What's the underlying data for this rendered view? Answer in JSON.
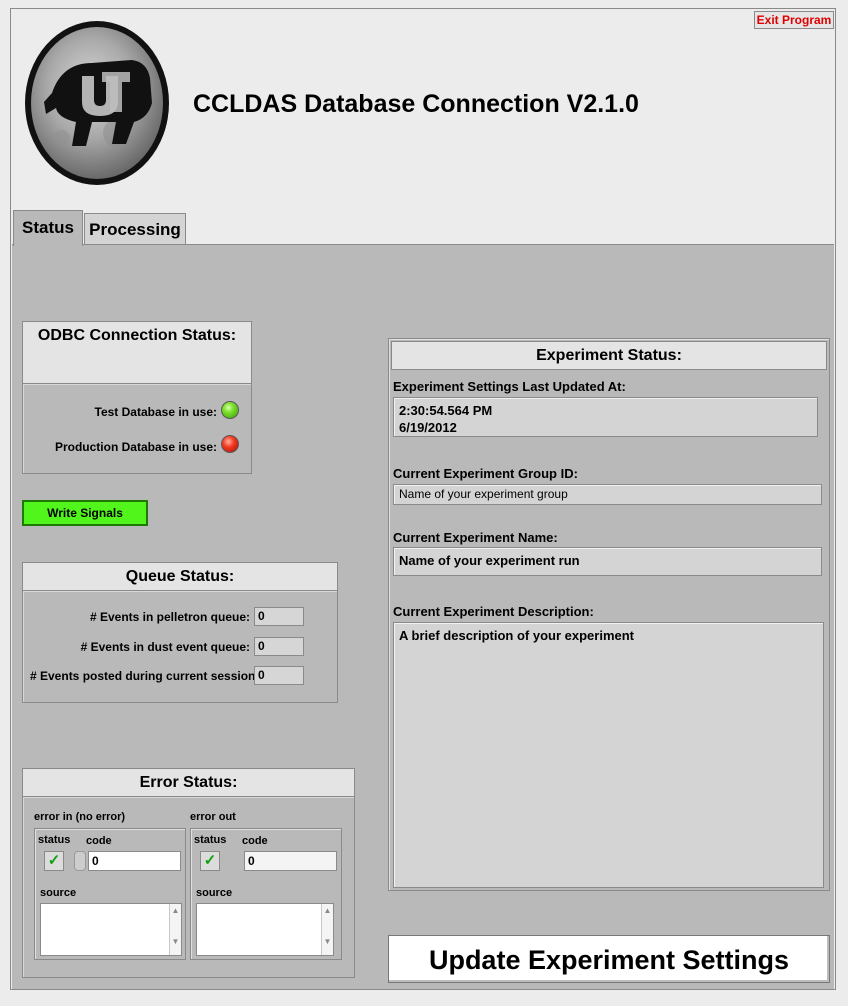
{
  "app": {
    "title": "CCLDAS Database Connection V2.1.0",
    "exit_label": "Exit Program",
    "logo_icon": "cu-buffalo-moon-logo"
  },
  "tabs": [
    {
      "label": "Status",
      "active": true
    },
    {
      "label": "Processing",
      "active": false
    }
  ],
  "odbc": {
    "title": "ODBC Connection Status:",
    "test_label": "Test Database in use:",
    "test_led": "green",
    "prod_label": "Production Database in use:",
    "prod_led": "red"
  },
  "write_signals_label": "Write Signals",
  "queue": {
    "title": "Queue Status:",
    "rows": [
      {
        "label": "# Events in pelletron queue:",
        "value": "0"
      },
      {
        "label": "# Events in dust event queue:",
        "value": "0"
      },
      {
        "label": "# Events posted during current session:",
        "value": "0"
      }
    ]
  },
  "error": {
    "title": "Error Status:",
    "error_in": {
      "title": "error in (no error)",
      "status_label": "status",
      "code_label": "code",
      "code": "0",
      "source_label": "source",
      "status_checked": true
    },
    "error_out": {
      "title": "error out",
      "status_label": "status",
      "code_label": "code",
      "code": "0",
      "source_label": "source",
      "status_checked": true
    }
  },
  "experiment": {
    "title": "Experiment Status:",
    "updated_label": "Experiment Settings Last Updated At:",
    "updated_time": "2:30:54.564 PM",
    "updated_date": "6/19/2012",
    "group_label": "Current Experiment Group ID:",
    "group_value": "Name of your experiment group",
    "name_label": "Current Experiment Name:",
    "name_value": "Name of your experiment run",
    "desc_label": "Current Experiment Description:",
    "desc_value": "A brief description of your experiment"
  },
  "update_button_label": "Update Experiment Settings",
  "colors": {
    "exit_text": "#e00000",
    "write_button": "#51f51b",
    "panel_bg": "#b9b9b9"
  }
}
